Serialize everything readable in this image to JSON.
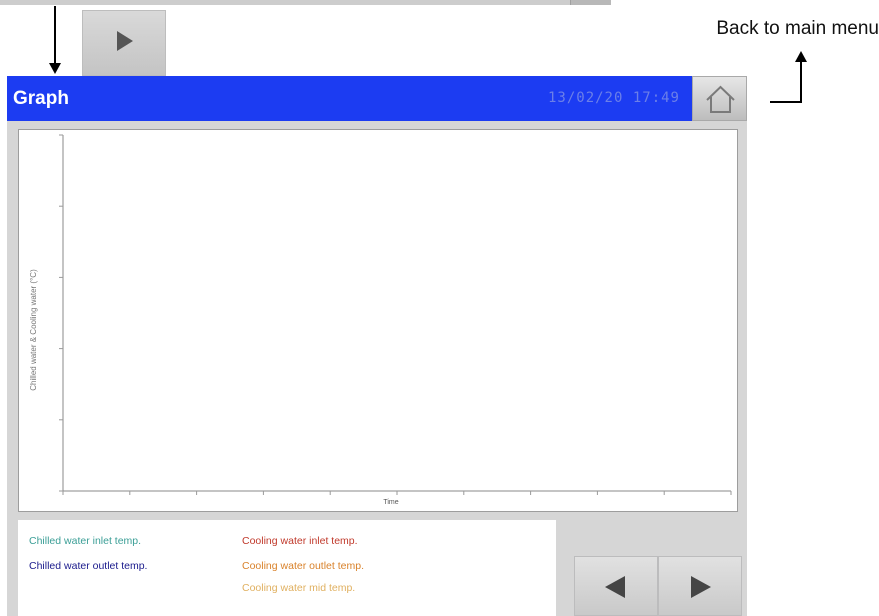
{
  "annotation": {
    "back_label": "Back to main menu"
  },
  "header": {
    "title": "Graph",
    "datetime": "13/02/20 17:49"
  },
  "icons": {
    "home": "home-icon",
    "play": "play-icon",
    "prev": "left-arrow-icon",
    "next": "right-arrow-icon"
  },
  "colors": {
    "title_bar": "#1c3cf2",
    "chilled_inlet": "#3a9e96",
    "chilled_outlet": "#1a1a8c",
    "cooling_inlet": "#c0392b",
    "cooling_outlet": "#d9822b",
    "cooling_mid": "#e0b060"
  },
  "chart_data": {
    "type": "line",
    "ylabel": "Chilled water & Cooling water (°C)",
    "xlabel": "Time",
    "series": [
      {
        "name": "Chilled water inlet temp.",
        "values": []
      },
      {
        "name": "Chilled water outlet temp.",
        "values": []
      },
      {
        "name": "Cooling water inlet temp.",
        "values": []
      },
      {
        "name": "Cooling water outlet temp.",
        "values": []
      },
      {
        "name": "Cooling water mid temp.",
        "values": []
      }
    ]
  },
  "legend": {
    "chilled_inlet": "Chilled water inlet temp.",
    "chilled_outlet": "Chilled water outlet temp.",
    "cooling_inlet": "Cooling water inlet temp.",
    "cooling_outlet": "Cooling water outlet temp.",
    "cooling_mid": "Cooling water mid temp."
  }
}
